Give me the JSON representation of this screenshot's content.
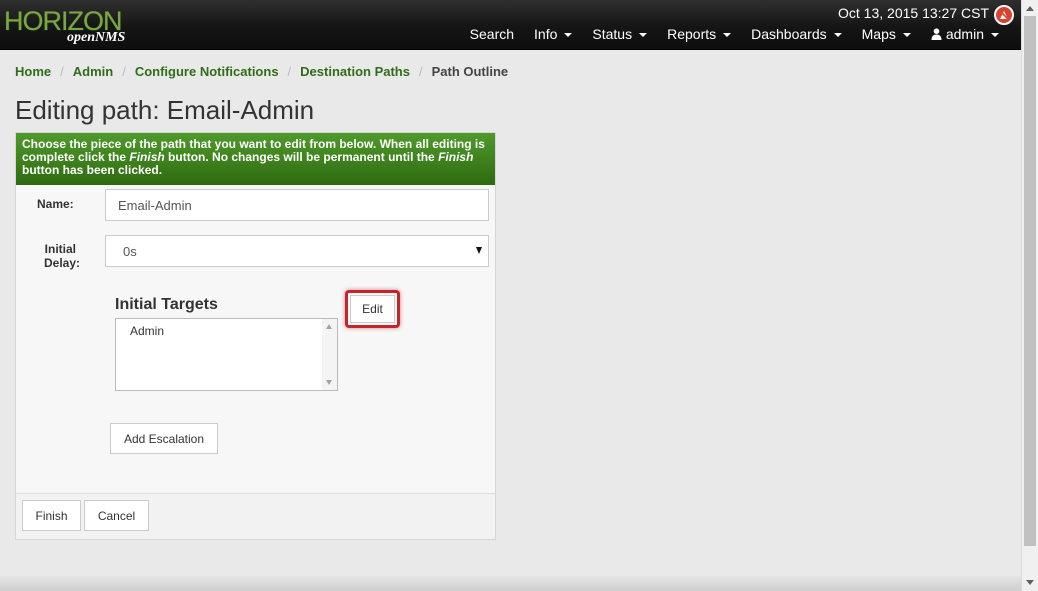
{
  "header": {
    "logo_main": "HORIZON",
    "logo_sub": "openNMS",
    "datetime": "Oct 13, 2015 13:27 CST",
    "nav": [
      {
        "label": "Search",
        "dropdown": false
      },
      {
        "label": "Info",
        "dropdown": true
      },
      {
        "label": "Status",
        "dropdown": true
      },
      {
        "label": "Reports",
        "dropdown": true
      },
      {
        "label": "Dashboards",
        "dropdown": true
      },
      {
        "label": "Maps",
        "dropdown": true
      },
      {
        "label": "admin",
        "dropdown": true
      }
    ]
  },
  "breadcrumb": [
    "Home",
    "Admin",
    "Configure Notifications",
    "Destination Paths",
    "Path Outline"
  ],
  "page_title": "Editing path: Email-Admin",
  "panel": {
    "heading_1": "Choose the piece of the path that you want to edit from below. When all editing is complete click the ",
    "heading_finish_1": "Finish",
    "heading_2": " button. No changes will be permanent until the ",
    "heading_finish_2": "Finish",
    "heading_3": " button has been clicked.",
    "name_label": "Name:",
    "name_value": "Email-Admin",
    "delay_label_1": "Initial",
    "delay_label_2": "Delay:",
    "delay_value": "0s",
    "targets_title": "Initial Targets",
    "targets": [
      "Admin"
    ],
    "edit_button": "Edit",
    "add_escalation_button": "Add Escalation",
    "finish_button": "Finish",
    "cancel_button": "Cancel"
  },
  "colors": {
    "accent": "#2f6d1a",
    "panel_heading": "#3d8220",
    "highlight": "#c0272d"
  }
}
